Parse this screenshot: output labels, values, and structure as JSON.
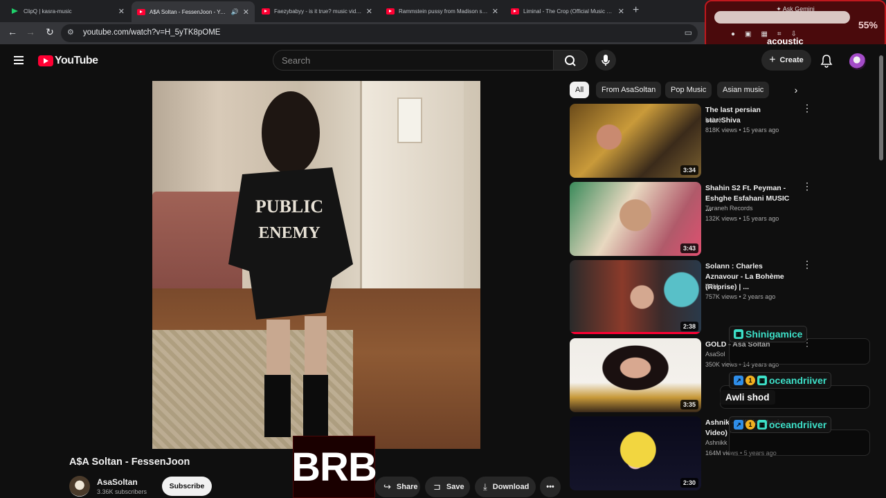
{
  "browser": {
    "tabs": [
      {
        "title": "ClipQ | kasra-music",
        "active": false
      },
      {
        "title": "A$A Soltan - FessenJoon - YouTube",
        "active": true
      },
      {
        "title": "Faezybabyy - is it true? music video - YouTube",
        "active": false
      },
      {
        "title": "Rammstein pussy from Madison square garden",
        "active": false
      },
      {
        "title": "Liminal - The Crop (Official Music Video)",
        "active": false
      }
    ],
    "url": "youtube.com/watch?v=H_5yTK8pOME"
  },
  "overlay": {
    "ask_gemini": "Ask Gemini",
    "percent": "55%",
    "label": "acoustic"
  },
  "header": {
    "logo_text": "YouTube",
    "search_placeholder": "Search",
    "create_label": "Create"
  },
  "video": {
    "title": "A$A Soltan - FessenJoon",
    "channel": "AsaSoltan",
    "subscribers": "3.36K subscribers",
    "subscribe_label": "Subscribe",
    "share_label": "Share",
    "save_label": "Save",
    "download_label": "Download",
    "shirt_text_1": "PUBLIC",
    "shirt_text_2": "ENEMY"
  },
  "brb": "BRB",
  "chips": [
    "All",
    "From AsaSoltan",
    "Pop Music",
    "Asian music"
  ],
  "recommendations": [
    {
      "title": "The last persian star:Shiva",
      "channel": "babak",
      "meta": "818K views • 15 years ago",
      "duration": "3:34"
    },
    {
      "title": "Shahin S2 Ft. Peyman - Eshghe Esfahani MUSIC ...",
      "channel": "Taraneh Records",
      "meta": "132K views • 15 years ago",
      "duration": "3:43"
    },
    {
      "title": "Solann : Charles Aznavour - La Bohème (Reprise) | ...",
      "channel": "WIM",
      "meta": "757K views • 2 years ago",
      "duration": "2:38"
    },
    {
      "title": "GOLD - Asa Soltan",
      "channel": "AsaSol",
      "meta": "350K views • 14 years ago",
      "duration": "3:35"
    },
    {
      "title": "Ashnik - Official Music Video)",
      "channel": "Ashnikk",
      "meta": "164M views • 5 years ago",
      "duration": "2:30"
    }
  ],
  "chat": [
    {
      "user": "Shinigamice"
    },
    {
      "user": "oceandriiver",
      "message": "Awli shod"
    },
    {
      "user": "oceandriiver"
    }
  ]
}
